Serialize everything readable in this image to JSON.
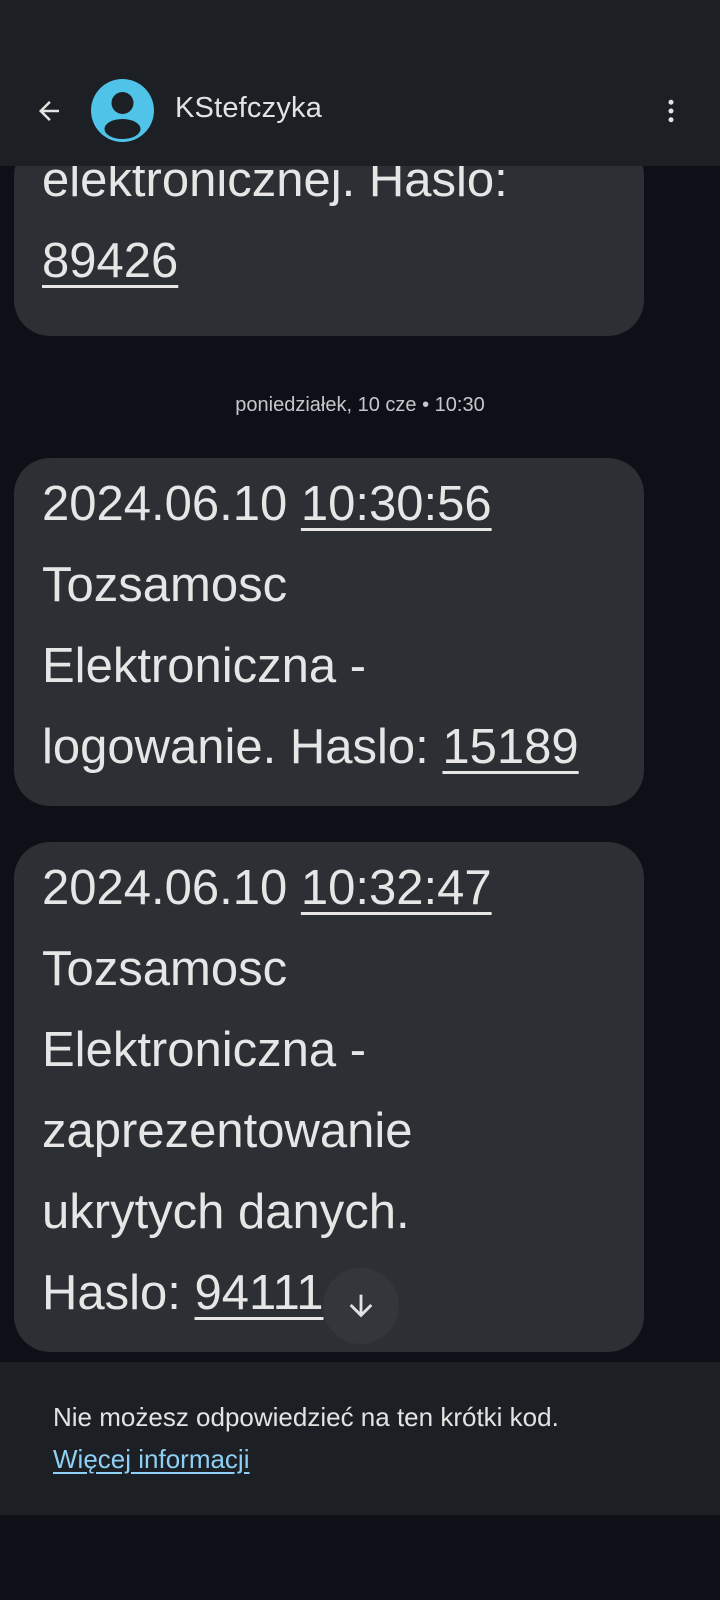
{
  "header": {
    "contact_name": "KStefczyka",
    "back_icon": "arrow-back-icon",
    "avatar_icon": "person-icon",
    "more_icon": "more-vert-icon",
    "avatar_color": "#4fc3e8"
  },
  "messages": {
    "date_separator": "poniedziałek, 10 cze • 10:30",
    "items": [
      {
        "line1": "elektronicznej. Haslo:",
        "code": "89426"
      },
      {
        "date": "2024.06.10",
        "time": "10:30:56",
        "line2": "Tozsamosc",
        "line3": "Elektroniczna -",
        "line4_prefix": "logowanie. Haslo:",
        "code": "15189"
      },
      {
        "date": "2024.06.10",
        "time": "10:32:47",
        "line2": "Tozsamosc",
        "line3": "Elektroniczna -",
        "line4": "zaprezentowanie",
        "line5": "ukrytych danych.",
        "line6_prefix": "Haslo:",
        "code": "94111"
      }
    ],
    "scroll_down_icon": "arrow-down-icon"
  },
  "footer": {
    "notice_text": "Nie możesz odpowiedzieć na ten krótki kod.",
    "more_info_link": "Więcej informacji"
  },
  "colors": {
    "background": "#0d1117",
    "bar": "#1c2024",
    "bubble": "#2c2f33",
    "link": "#8ecff5"
  }
}
